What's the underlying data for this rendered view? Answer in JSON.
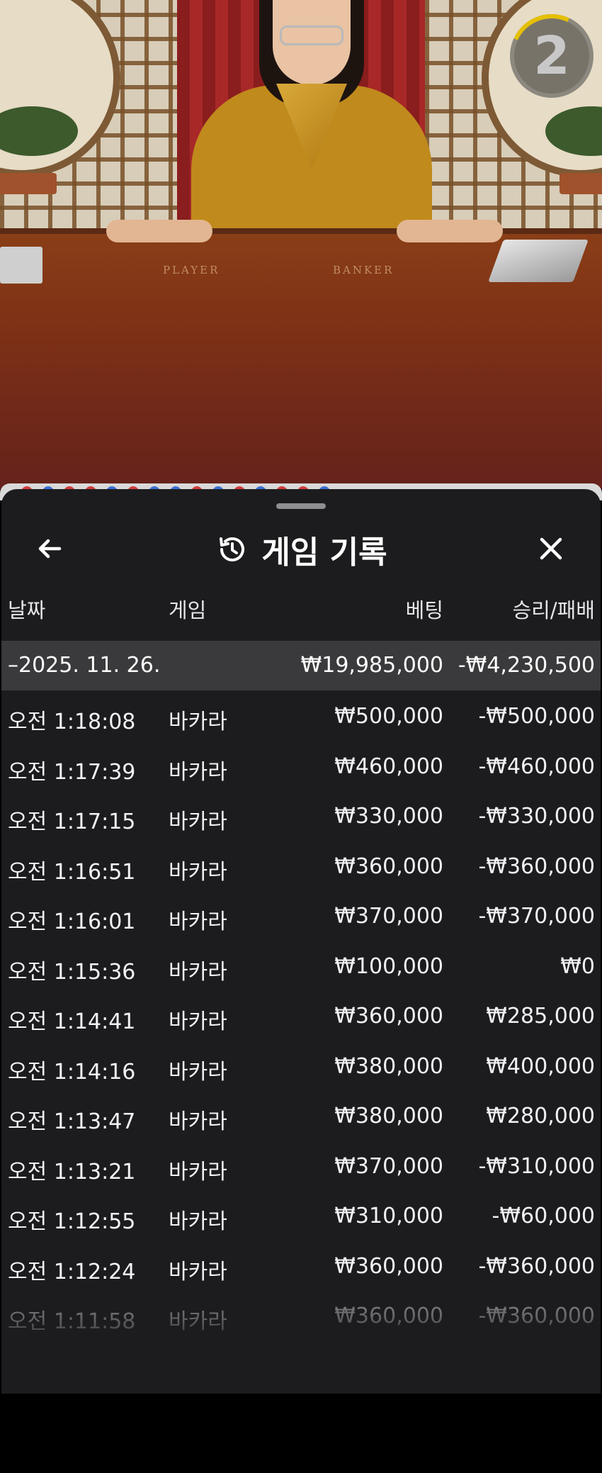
{
  "video": {
    "table_labels": {
      "player": "PLAYER",
      "banker": "BANKER"
    },
    "round_number": "2"
  },
  "history": {
    "title": "게임 기록",
    "icons": {
      "back": "arrow-left-icon",
      "history": "history-clock-icon",
      "close": "close-x-icon"
    },
    "columns": {
      "time": "날짜",
      "game": "게임",
      "bet": "베팅",
      "result": "승리/패배"
    },
    "summary": {
      "date": "–2025. 11. 26.",
      "bet_total": "₩19,985,000",
      "result_total": "-₩4,230,500"
    },
    "rows": [
      {
        "time": "오전 1:18:08",
        "game": "바카라",
        "bet": "₩500,000",
        "result": "-₩500,000"
      },
      {
        "time": "오전 1:17:39",
        "game": "바카라",
        "bet": "₩460,000",
        "result": "-₩460,000"
      },
      {
        "time": "오전 1:17:15",
        "game": "바카라",
        "bet": "₩330,000",
        "result": "-₩330,000"
      },
      {
        "time": "오전 1:16:51",
        "game": "바카라",
        "bet": "₩360,000",
        "result": "-₩360,000"
      },
      {
        "time": "오전 1:16:01",
        "game": "바카라",
        "bet": "₩370,000",
        "result": "-₩370,000"
      },
      {
        "time": "오전 1:15:36",
        "game": "바카라",
        "bet": "₩100,000",
        "result": "₩0"
      },
      {
        "time": "오전 1:14:41",
        "game": "바카라",
        "bet": "₩360,000",
        "result": "₩285,000"
      },
      {
        "time": "오전 1:14:16",
        "game": "바카라",
        "bet": "₩380,000",
        "result": "₩400,000"
      },
      {
        "time": "오전 1:13:47",
        "game": "바카라",
        "bet": "₩380,000",
        "result": "₩280,000"
      },
      {
        "time": "오전 1:13:21",
        "game": "바카라",
        "bet": "₩370,000",
        "result": "-₩310,000"
      },
      {
        "time": "오전 1:12:55",
        "game": "바카라",
        "bet": "₩310,000",
        "result": "-₩60,000"
      },
      {
        "time": "오전 1:12:24",
        "game": "바카라",
        "bet": "₩360,000",
        "result": "-₩360,000"
      },
      {
        "time": "오전 1:11:58",
        "game": "바카라",
        "bet": "₩360,000",
        "result": "-₩360,000"
      }
    ]
  },
  "colors": {
    "panel_bg": "#1c1c1e",
    "summary_bg": "#3a3a3c",
    "text": "#ffffff",
    "round_accent": "#e5c000"
  }
}
